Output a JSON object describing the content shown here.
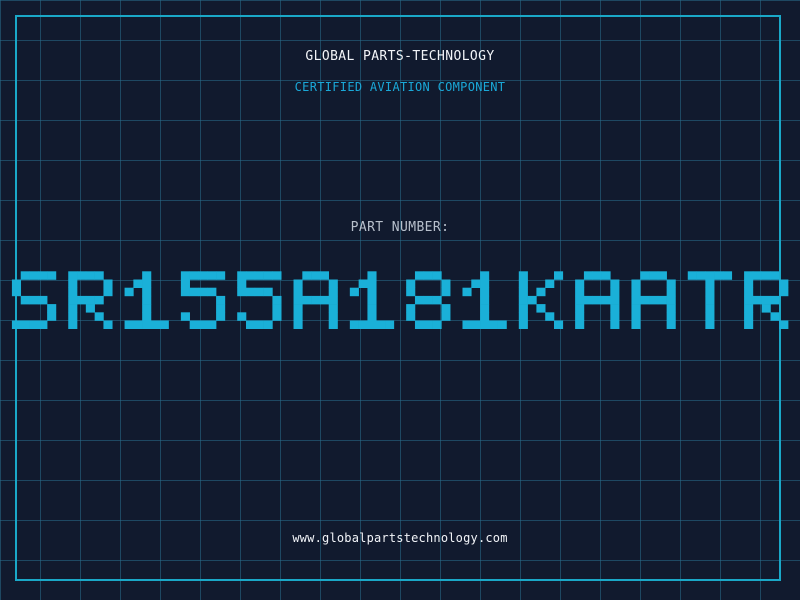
{
  "header": {
    "company": "GLOBAL PARTS-TECHNOLOGY",
    "subtitle": "CERTIFIED AVIATION COMPONENT"
  },
  "part": {
    "label": "PART NUMBER:",
    "number": "SR155A181KAATR"
  },
  "footer": {
    "website": "www.globalpartstechnology.com"
  },
  "colors": {
    "background": "#111a2e",
    "grid": "#286e8c",
    "accent": "#1aa8d8",
    "part_number": "#1ab0d8",
    "text": "#f2f4f8",
    "label": "#b8c0cc"
  }
}
